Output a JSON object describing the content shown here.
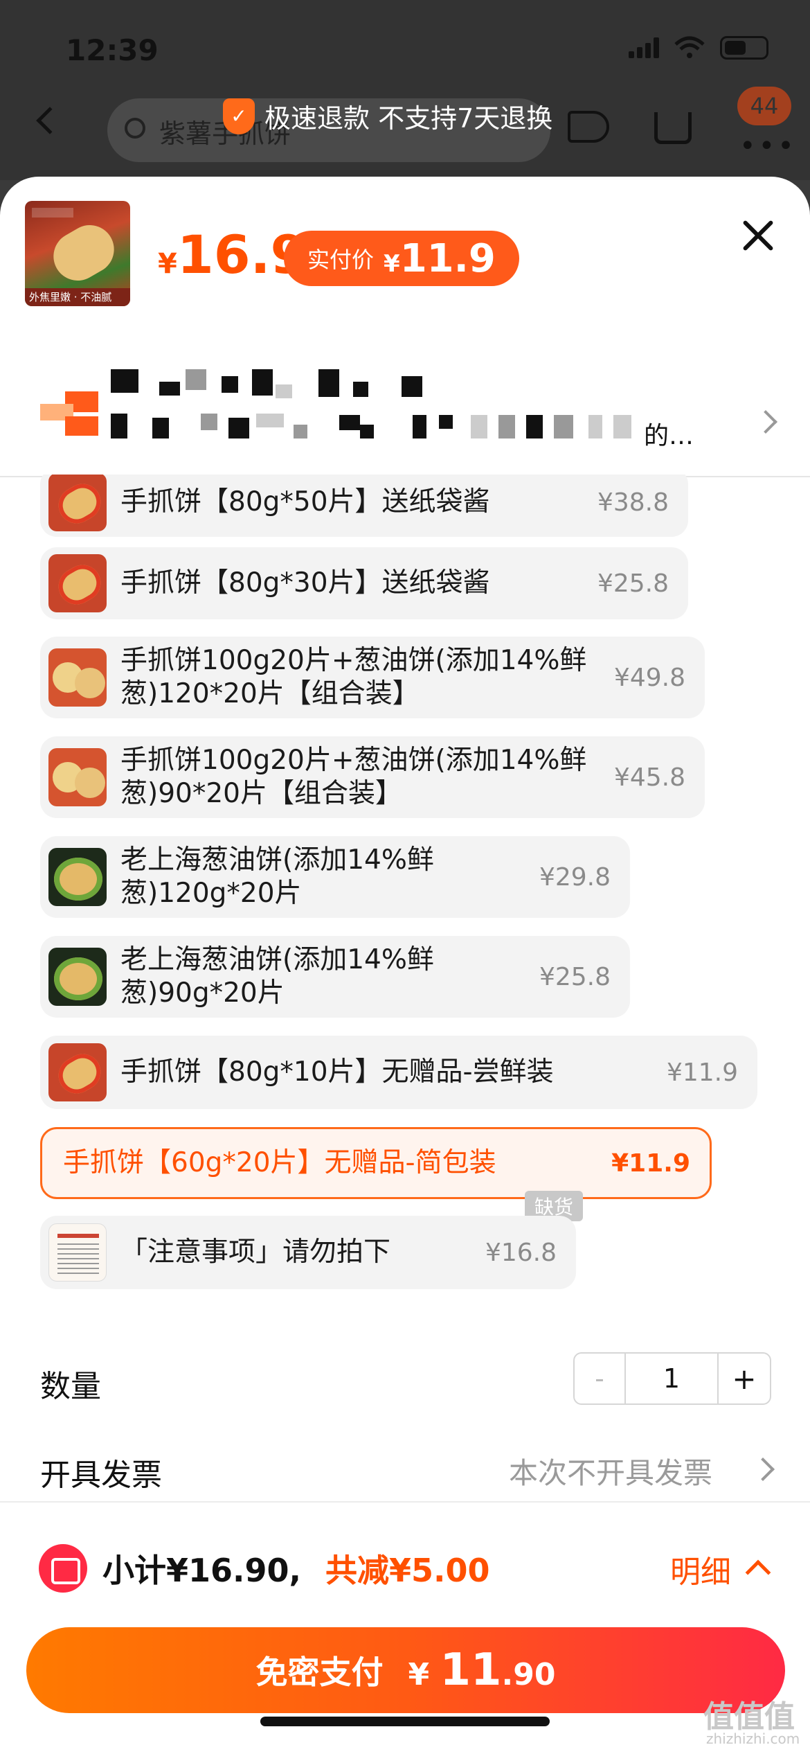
{
  "status_bar": {
    "time": "12:39"
  },
  "nav": {
    "search_placeholder": "紫薯手抓饼",
    "cart_badge": "44"
  },
  "toast": {
    "text": "极速退款 不支持7天退换"
  },
  "product": {
    "price_symbol": "¥",
    "price": "16.9",
    "pay_label": "实付价",
    "pay_symbol": "¥",
    "pay_amount": "11.9",
    "thumb_caption": "外焦里嫩 · 不油腻"
  },
  "address": {
    "tail_text": "的…"
  },
  "skus": [
    {
      "name": "手抓饼【80g*50片】送纸袋酱",
      "price": "¥38.8",
      "thumb": "roll"
    },
    {
      "name": "手抓饼【80g*30片】送纸袋酱",
      "price": "¥25.8",
      "thumb": "roll"
    },
    {
      "name": "手抓饼100g20片+葱油饼(添加14%鲜葱)120*20片【组合装】",
      "price": "¥49.8",
      "thumb": "combo"
    },
    {
      "name": "手抓饼100g20片+葱油饼(添加14%鲜葱)90*20片【组合装】",
      "price": "¥45.8",
      "thumb": "combo"
    },
    {
      "name": "老上海葱油饼(添加14%鲜葱)120g*20片",
      "price": "¥29.8",
      "thumb": "scallion"
    },
    {
      "name": "老上海葱油饼(添加14%鲜葱)90g*20片",
      "price": "¥25.8",
      "thumb": "scallion"
    },
    {
      "name": "手抓饼【80g*10片】无赠品-尝鲜装",
      "price": "¥11.9",
      "thumb": "roll"
    },
    {
      "name": "手抓饼【60g*20片】无赠品-简包装",
      "price": "¥11.9",
      "selected": true
    },
    {
      "name": "「注意事项」请勿拍下",
      "price": "¥16.8",
      "thumb": "notice"
    }
  ],
  "out_of_stock_label": "缺货",
  "quantity": {
    "label": "数量",
    "minus": "-",
    "value": "1",
    "plus": "+"
  },
  "invoice": {
    "label": "开具发票",
    "value": "本次不开具发票"
  },
  "footer": {
    "subtotal": "小计¥16.90,",
    "saved": "共减¥5.00",
    "detail": "明细",
    "pay_label": "免密支付",
    "pay_symbol": "¥",
    "pay_int": "11",
    "pay_dec": ".90"
  },
  "watermark": {
    "text": "值值值",
    "sub": "zhizhizhi.com"
  },
  "colors": {
    "accent": "#ff5000",
    "selected_bg": "#fff4ee",
    "pay_gradient_start": "#ff7a00",
    "pay_gradient_end": "#ff2a44"
  }
}
